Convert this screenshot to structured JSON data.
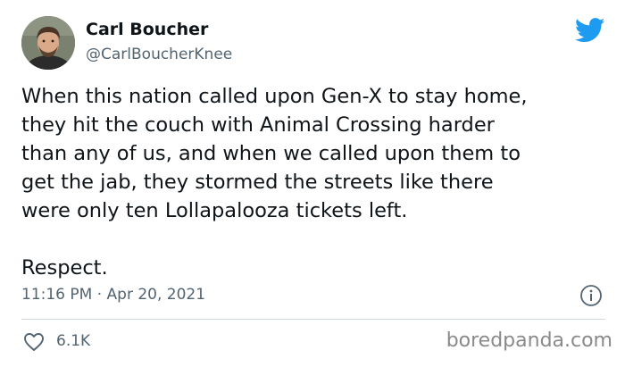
{
  "user": {
    "display_name": "Carl Boucher",
    "handle": "@CarlBoucherKnee",
    "avatar_icon": "profile-photo"
  },
  "tweet": {
    "text": "When this nation called upon Gen-X to stay home,\nthey hit the couch with Animal Crossing harder\nthan any of us, and when we called upon them to\nget the jab, they stormed the streets like there\nwere only ten Lollapalooza tickets left.\n\nRespect.",
    "timestamp": "11:16 PM · Apr 20, 2021"
  },
  "actions": {
    "likes": "6.1K",
    "like_icon": "heart-outline-icon",
    "info_icon": "info-icon"
  },
  "branding": {
    "twitter_icon": "twitter-bird-icon",
    "watermark": "boredpanda.com"
  },
  "colors": {
    "twitter_blue": "#1d9bf0",
    "secondary_text": "#536471",
    "primary_text": "#0f1419",
    "divider": "#cfd9de"
  }
}
